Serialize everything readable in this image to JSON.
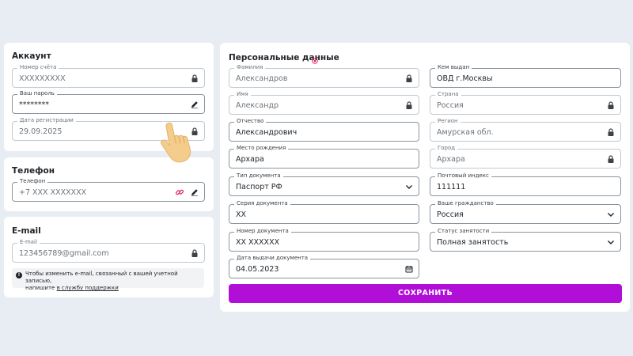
{
  "account": {
    "title": "Аккаунт",
    "account_number": {
      "label": "Номер счёта",
      "value": "XXXXXXXXX"
    },
    "password": {
      "label": "Ваш пароль",
      "value": "********"
    },
    "reg_date": {
      "label": "Дата регистрации",
      "value": "29.09.2025"
    }
  },
  "phone": {
    "title": "Телефон",
    "field": {
      "label": "Телефон",
      "value": "+7 XXX XXXXXXX"
    }
  },
  "email": {
    "title": "E-mail",
    "field": {
      "label": "E-mail",
      "value": "123456789@gmail.com"
    },
    "note_text": "Чтобы изменить e-mail, связанный с вашей учетной записью,",
    "note_text2": "напишите",
    "note_link": "в службу поддержки"
  },
  "personal": {
    "title": "Персональные данные",
    "surname": {
      "label": "Фамилия",
      "value": "Александров"
    },
    "name": {
      "label": "Имя",
      "value": "Александр"
    },
    "patronymic": {
      "label": "Отчество",
      "value": "Александрович"
    },
    "birthplace": {
      "label": "Место рождения",
      "value": "Архара"
    },
    "doc_type": {
      "label": "Тип документа",
      "value": "Паспорт РФ"
    },
    "doc_series": {
      "label": "Серия документа",
      "value": "XX"
    },
    "doc_number": {
      "label": "Номер документа",
      "value": "XX XXXXXX"
    },
    "doc_date": {
      "label": "Дата выдачи документа",
      "value": "04.05.2023"
    },
    "issued_by": {
      "label": "Кем выдан",
      "value": "ОВД г.Москвы"
    },
    "country": {
      "label": "Страна",
      "value": "Россия"
    },
    "region": {
      "label": "Регион",
      "value": "Амурская обл."
    },
    "city": {
      "label": "Город",
      "value": "Архара"
    },
    "postal_code": {
      "label": "Почтовый индекс",
      "value": "111111"
    },
    "citizenship": {
      "label": "Ваше гражданство",
      "value": "Россия"
    },
    "employment": {
      "label": "Статус занятости",
      "value": "Полная занятость"
    },
    "save_label": "СОХРАНИТЬ"
  },
  "colors": {
    "accent": "#b10fd8",
    "required": "#e0245e",
    "link_icon": "#e0245e"
  },
  "icons": {
    "locked": "lock-icon",
    "editable": "pencil-icon",
    "link": "link-icon",
    "select": "chevron-down-icon",
    "date": "calendar-icon"
  }
}
